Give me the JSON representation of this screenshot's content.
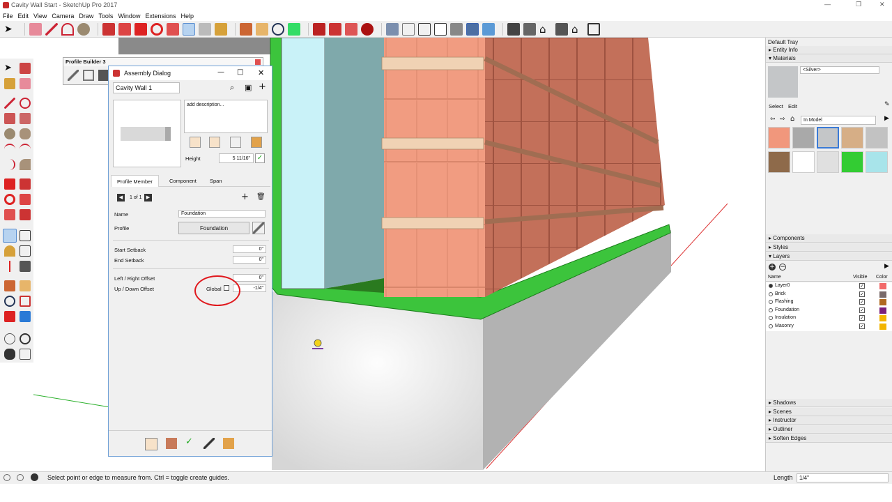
{
  "window": {
    "title": "Cavity Wall Start - SketchUp Pro 2017",
    "controls": [
      "—",
      "❐",
      "✕"
    ]
  },
  "menu": [
    "File",
    "Edit",
    "View",
    "Camera",
    "Draw",
    "Tools",
    "Window",
    "Extensions",
    "Help"
  ],
  "profile_builder": {
    "title": "Profile Builder 3"
  },
  "assembly": {
    "title": "Assembly Dialog",
    "name_value": "Cavity Wall 1",
    "description": "add description...",
    "height_label": "Height",
    "height_value": "5 11/16\"",
    "tabs": [
      "Profile Member",
      "Component",
      "Span"
    ],
    "pager": "1 of 1",
    "name_label": "Name",
    "member_name": "Foundation",
    "profile_label": "Profile",
    "profile_value": "Foundation",
    "start_setback_label": "Start Setback",
    "start_setback": "0\"",
    "end_offset_label": "End Setback",
    "end_setback": "0\"",
    "lr_label": "Left / Right Offset",
    "lr_value": "0\"",
    "ud_label": "Up / Down Offset",
    "global_label": "Global",
    "ud_value": "-1/4\""
  },
  "tray": {
    "title": "Default Tray",
    "entity_info": "Entity Info",
    "materials": "Materials",
    "material_name": "<Silver>",
    "select_tab": "Select",
    "edit_tab": "Edit",
    "library": "In Model",
    "swatches": [
      "#f1977c",
      "#a9a9a9",
      "#c4c6c8",
      "#d6ae86",
      "#c2c2c2",
      "#8e6a4a",
      "#ffffff",
      "#e0e0e0",
      "#33cc33",
      "#a8e4ea"
    ],
    "components": "Components",
    "styles": "Styles",
    "layers": "Layers",
    "col_name": "Name",
    "col_visible": "Visible",
    "col_color": "Color",
    "layer_rows": [
      {
        "name": "Layer0",
        "color": "#f26a6a"
      },
      {
        "name": "Brick",
        "color": "#7a6a6a"
      },
      {
        "name": "Flashing",
        "color": "#b06a20"
      },
      {
        "name": "Foundation",
        "color": "#7a1f7a"
      },
      {
        "name": "Insulation",
        "color": "#f2b400"
      },
      {
        "name": "Masonry",
        "color": "#f2b400"
      }
    ],
    "bottom_panels": [
      "Shadows",
      "Scenes",
      "Instructor",
      "Outliner",
      "Soften Edges"
    ]
  },
  "status": {
    "message": "Select point or edge to measure from.  Ctrl = toggle create guides.",
    "length_label": "Length",
    "length_value": "1/4\""
  }
}
